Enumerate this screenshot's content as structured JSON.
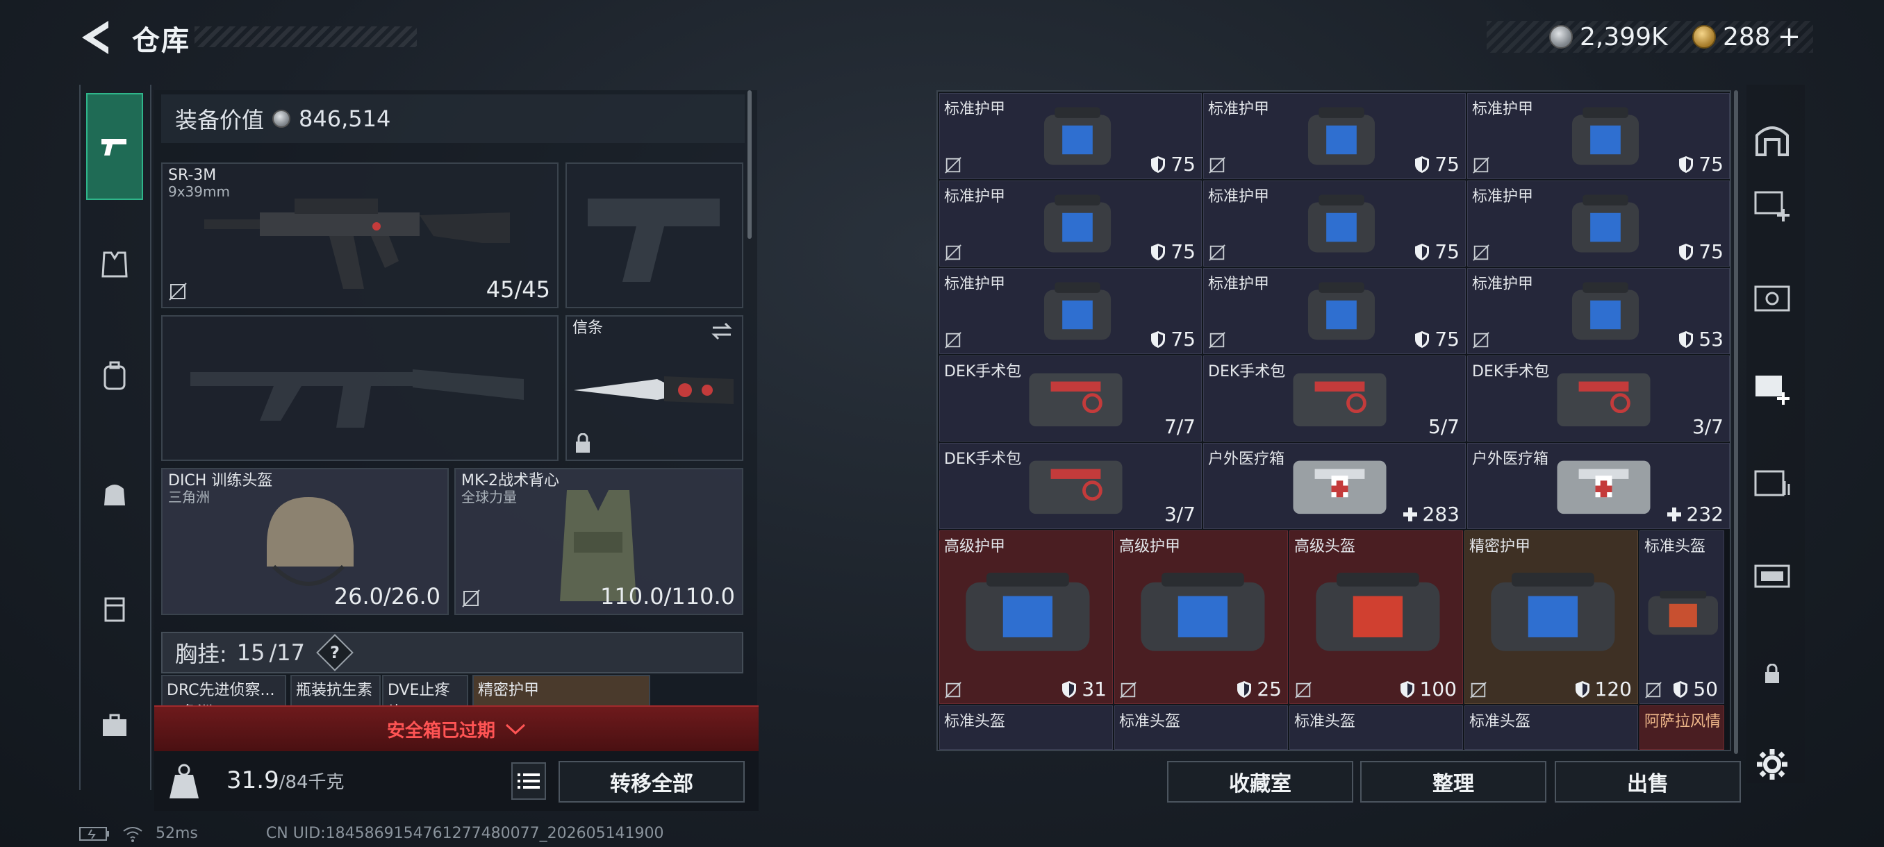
{
  "header": {
    "title": "仓库"
  },
  "currency": {
    "silver": "2,399K",
    "gold": "288",
    "gold_add": "+"
  },
  "equipment": {
    "value_label": "装备价值",
    "value": "846,514",
    "primary_weapon": {
      "name": "SR-3M",
      "caliber": "9x39mm",
      "ammo": "45/45"
    },
    "melee": {
      "name": "信条"
    },
    "helmet": {
      "name": "DICH 训练头盔",
      "faction": "三角洲",
      "durability": "26.0/26.0"
    },
    "vest": {
      "name": "MK-2战术背心",
      "faction": "全球力量",
      "durability": "110.0/110.0"
    },
    "chest_rig": {
      "label": "胸挂:",
      "used": "15",
      "capacity": "/17",
      "help": "?"
    },
    "chest_items": [
      "DRC先进侦察...",
      "瓶装抗生素",
      "DVE止疼片",
      "精密护甲"
    ],
    "chest_items_sub": "三角洲",
    "safebox_warning": "安全箱已过期",
    "weight": "31.9",
    "weight_limit": "/84千克",
    "transfer_all": "转移全部"
  },
  "storage": {
    "rows": [
      [
        {
          "name": "标准护甲",
          "value": "75",
          "kind": "shield",
          "tone": "normal"
        },
        {
          "name": "标准护甲",
          "value": "75",
          "kind": "shield",
          "tone": "normal"
        },
        {
          "name": "标准护甲",
          "value": "75",
          "kind": "shield",
          "tone": "normal"
        }
      ],
      [
        {
          "name": "标准护甲",
          "value": "75",
          "kind": "shield",
          "tone": "normal"
        },
        {
          "name": "标准护甲",
          "value": "75",
          "kind": "shield",
          "tone": "normal"
        },
        {
          "name": "标准护甲",
          "value": "75",
          "kind": "shield",
          "tone": "normal"
        }
      ],
      [
        {
          "name": "标准护甲",
          "value": "75",
          "kind": "shield",
          "tone": "normal"
        },
        {
          "name": "标准护甲",
          "value": "75",
          "kind": "shield",
          "tone": "normal"
        },
        {
          "name": "标准护甲",
          "value": "53",
          "kind": "shield",
          "tone": "normal"
        }
      ],
      [
        {
          "name": "DEK手术包",
          "value": "7/7",
          "kind": "count",
          "tone": "normal"
        },
        {
          "name": "DEK手术包",
          "value": "5/7",
          "kind": "count",
          "tone": "normal"
        },
        {
          "name": "DEK手术包",
          "value": "3/7",
          "kind": "count",
          "tone": "normal"
        }
      ],
      [
        {
          "name": "DEK手术包",
          "value": "3/7",
          "kind": "count",
          "tone": "normal"
        },
        {
          "name": "户外医疗箱",
          "value": "283",
          "kind": "heal",
          "tone": "normal"
        },
        {
          "name": "户外医疗箱",
          "value": "232",
          "kind": "heal",
          "tone": "normal"
        }
      ]
    ],
    "big_row": [
      {
        "name": "高级护甲",
        "value": "31",
        "tone": "red"
      },
      {
        "name": "高级护甲",
        "value": "25",
        "tone": "red"
      },
      {
        "name": "高级头盔",
        "value": "100",
        "tone": "red"
      },
      {
        "name": "精密护甲",
        "value": "120",
        "tone": "gold"
      },
      {
        "name": "标准头盔",
        "value": "50",
        "tone": "normal"
      }
    ],
    "last_row": [
      "标准头盔",
      "标准头盔",
      "标准头盔",
      "标准头盔",
      "阿萨拉风情"
    ]
  },
  "buttons": {
    "collection": "收藏室",
    "organize": "整理",
    "sell": "出售"
  },
  "status": {
    "ping": "52ms",
    "uid": "CN UID:1845869154761277480077_202605141900"
  },
  "colors": {
    "accent": "#2fb58a",
    "warning": "#ff5454",
    "rare_red": "#4a1e22",
    "rare_gold": "#3e3024"
  }
}
